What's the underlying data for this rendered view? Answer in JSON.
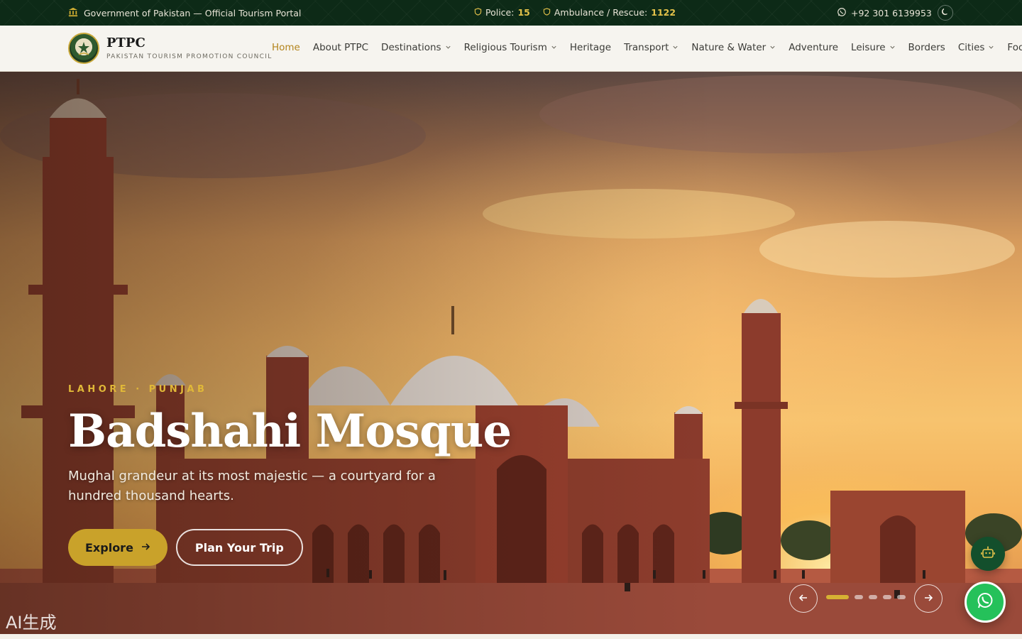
{
  "topbar": {
    "gov_label": "Government of Pakistan — Official Tourism Portal",
    "police_label": "Police:",
    "police_number": "15",
    "ambulance_label": "Ambulance / Rescue:",
    "ambulance_number": "1122",
    "phone": "+92 301 6139953",
    "icons": [
      "government-building-icon",
      "shield-icon",
      "whatsapp-icon",
      "moon-icon"
    ]
  },
  "brand": {
    "name": "PTPC",
    "subtitle": "PAKISTAN TOURISM PROMOTION COUNCIL"
  },
  "nav": {
    "items": [
      {
        "label": "Home",
        "active": true,
        "dropdown": false
      },
      {
        "label": "About PTPC",
        "dropdown": false
      },
      {
        "label": "Destinations",
        "dropdown": true
      },
      {
        "label": "Religious Tourism",
        "dropdown": true
      },
      {
        "label": "Heritage",
        "dropdown": false
      },
      {
        "label": "Transport",
        "dropdown": true
      },
      {
        "label": "Nature & Water",
        "dropdown": true
      },
      {
        "label": "Adventure",
        "dropdown": false
      },
      {
        "label": "Leisure",
        "dropdown": true
      },
      {
        "label": "Borders",
        "dropdown": false
      },
      {
        "label": "Cities",
        "dropdown": true
      },
      {
        "label": "Food & Cu",
        "dropdown": false
      }
    ],
    "active_color": "#b3841c"
  },
  "hero": {
    "kicker": "LAHORE · PUNJAB",
    "title": "Badshahi Mosque",
    "description": "Mughal grandeur at its most majestic — a courtyard for a hundred thousand hearts.",
    "primary_button": "Explore",
    "secondary_button": "Plan Your Trip",
    "slide_count": 5,
    "active_slide": 1,
    "watermark": "AI生成"
  },
  "colors": {
    "topbar_bg": "#0d2a17",
    "accent_gold": "#c9a22a",
    "bot_button": "#134f2c",
    "whatsapp": "#25c15a"
  }
}
